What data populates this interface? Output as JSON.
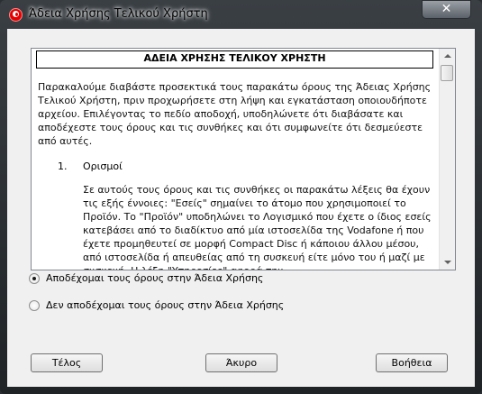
{
  "window": {
    "title": "Άδεια Χρήσης Τελικού Χρήστη",
    "close_label": "✕"
  },
  "license": {
    "heading": "ΑΔΕΙΑ ΧΡΗΣΗΣ ΤΕΛΙΚΟΥ ΧΡΗΣΤΗ",
    "intro": "Παρακαλούμε διαβάστε προσεκτικά τους παρακάτω όρους της Άδειας Χρήσης Τελικού Χρήστη, πριν προχωρήσετε στη λήψη και εγκατάσταση οποιουδήποτε αρχείου. Επιλέγοντας το πεδίο αποδοχή, υποδηλώνετε ότι διαβάσατε και αποδέχεστε τους όρους και τις συνθήκες και ότι συμφωνείτε ότι δεσμεύεστε από αυτές.",
    "section_number": "1.",
    "section_title": "Ορισμοί",
    "section_text": "Σε αυτούς τους όρους και τις συνθήκες οι παρακάτω λέξεις θα έχουν τις εξής έννοιες: \"Εσείς\" σημαίνει το άτομο που χρησιμοποιεί το Προϊόν. Το \"Προϊόν\" υποδηλώνει το Λογισμικό που έχετε ο ίδιος εσείς κατεβάσει από το διαδίκτυο από μία ιστοσελίδα της  Vodafone ή που έχετε προμηθευτεί σε μορφή Compact Disc ή κάποιου άλλου μέσου, από ιστοσελίδα ή απευθείας από τη συσκευή είτε μόνο του ή μαζί με συσκευή. Η λέξη \"Υπηρεσίες\" αφορά την"
  },
  "options": {
    "accept_label": "Αποδέχομαι τους όρους στην Άδεια Χρήσης",
    "decline_label": "Δεν αποδέχομαι τους όρους στην Άδεια Χρήσης",
    "selected": "accept"
  },
  "buttons": {
    "finish": "Τέλος",
    "cancel": "Άκυρο",
    "help": "Βοήθεια"
  }
}
